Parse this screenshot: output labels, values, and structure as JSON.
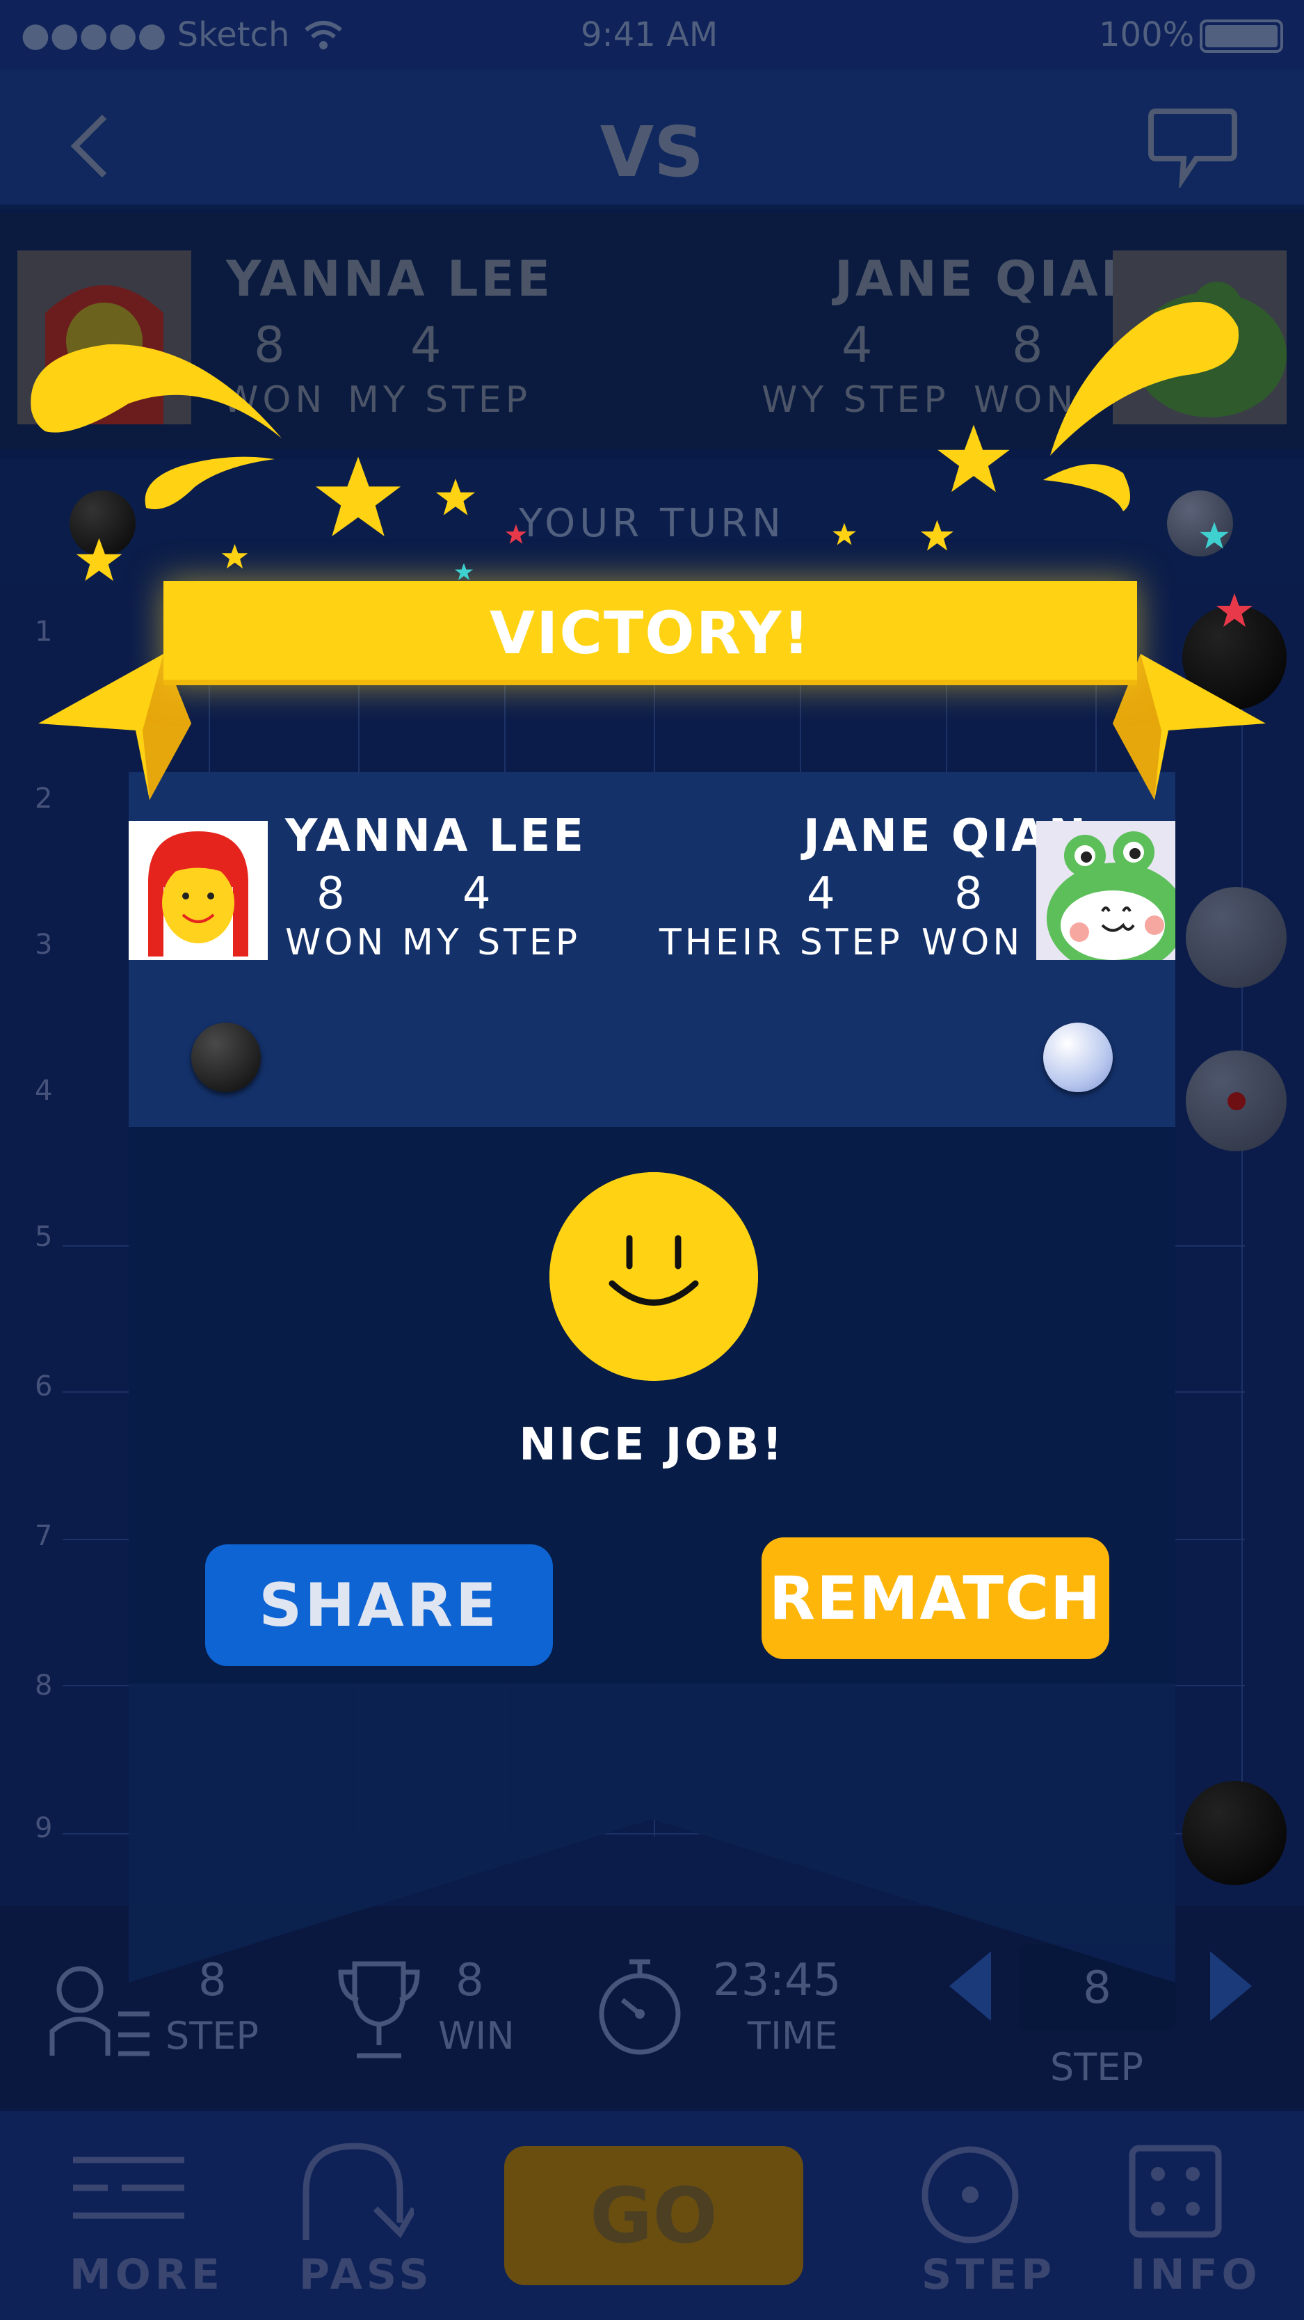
{
  "status_bar": {
    "carrier": "●●●●● Sketch",
    "time": "9:41 AM",
    "battery": "100%"
  },
  "nav": {
    "title": "VS",
    "back_icon": "chevron-left-icon",
    "chat_icon": "chat-bubble-icon"
  },
  "background_players": {
    "left": {
      "name": "YANNA LEE",
      "won": "8",
      "step": "4",
      "won_label": "WON",
      "step_label": "MY STEP"
    },
    "right": {
      "name": "JANE QIAN",
      "step": "4",
      "won": "8",
      "step_label": "WY STEP",
      "won_label": "WON"
    }
  },
  "turn": {
    "text": "YOUR TURN"
  },
  "board": {
    "rows": [
      "1",
      "2",
      "3",
      "4",
      "5",
      "6",
      "7",
      "8",
      "9"
    ]
  },
  "bottom_stats": {
    "step": {
      "value": "8",
      "label": "STEP"
    },
    "win": {
      "value": "8",
      "label": "WIN"
    },
    "time": {
      "value": "23:45",
      "label": "TIME"
    },
    "pager": {
      "value": "8",
      "label": "STEP"
    }
  },
  "tab_bar": {
    "more": "MORE",
    "pass": "PASS",
    "go": "GO",
    "step": "STEP",
    "info": "INFO"
  },
  "modal": {
    "banner": "VICTORY!",
    "left_player": {
      "name": "YANNA LEE",
      "won": "8",
      "step": "4",
      "won_label": "WON",
      "step_label": "MY STEP",
      "stone": "black"
    },
    "right_player": {
      "name": "JANE QIAN",
      "step": "4",
      "won": "8",
      "step_label": "THEIR STEP",
      "won_label": "WON",
      "stone": "white"
    },
    "message": "NICE JOB!",
    "share_label": "SHARE",
    "rematch_label": "REMATCH"
  },
  "colors": {
    "accent_yellow": "#ffd314",
    "share_blue": "#0e64d2",
    "rematch_orange": "#ffb60b",
    "background": "#0a1a46"
  }
}
